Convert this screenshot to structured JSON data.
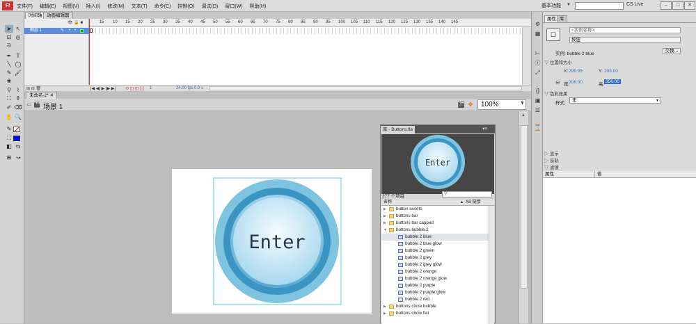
{
  "menubar": {
    "logo": "Fl",
    "items": [
      "文件(F)",
      "编辑(E)",
      "视图(V)",
      "插入(I)",
      "修改(M)",
      "文本(T)",
      "命令(C)",
      "控制(O)",
      "调试(D)",
      "窗口(W)",
      "帮助(H)"
    ],
    "workspace": "基本功能",
    "cslive": "CS Live"
  },
  "timeline": {
    "tabs": [
      "时间轴",
      "动画编辑器"
    ],
    "layer_name": "图层 1",
    "frame_numbers": [
      "1",
      "5",
      "10",
      "15",
      "20",
      "25",
      "30",
      "35",
      "40",
      "45",
      "50",
      "55",
      "60",
      "65",
      "70",
      "75",
      "80",
      "85",
      "90",
      "95",
      "100",
      "105",
      "110",
      "115",
      "120",
      "125",
      "130",
      "135",
      "140",
      "145"
    ],
    "footer_current_frame": "1",
    "fps": "24.00 fps",
    "time": "0.0 s"
  },
  "document": {
    "tab": "未命名-2*",
    "scene": "场景 1",
    "zoom": "100%"
  },
  "button_symbol": {
    "label": "Enter"
  },
  "library": {
    "title": "库 - Buttons.fla",
    "preview_label": "Enter",
    "count": "277 个项目",
    "col_name": "名称",
    "col_linkage": "AS 链接",
    "items": [
      {
        "name": "button assets",
        "type": "folder",
        "expand": "closed",
        "indent": 0
      },
      {
        "name": "buttons bar",
        "type": "folder",
        "expand": "closed",
        "indent": 0
      },
      {
        "name": "buttons bar capped",
        "type": "folder",
        "expand": "closed",
        "indent": 0
      },
      {
        "name": "buttons bubble 2",
        "type": "folder",
        "expand": "open",
        "indent": 0
      },
      {
        "name": "bubble 2 blue",
        "type": "symbol",
        "expand": "",
        "indent": 1,
        "selected": true
      },
      {
        "name": "bubble 2 blue glow",
        "type": "symbol",
        "expand": "",
        "indent": 1
      },
      {
        "name": "bubble 2 green",
        "type": "symbol",
        "expand": "",
        "indent": 1
      },
      {
        "name": "bubble 2 grey",
        "type": "symbol",
        "expand": "",
        "indent": 1
      },
      {
        "name": "bubble 2 grey glow",
        "type": "symbol",
        "expand": "",
        "indent": 1
      },
      {
        "name": "bubble 2 orange",
        "type": "symbol",
        "expand": "",
        "indent": 1
      },
      {
        "name": "bubble 2 orange glow",
        "type": "symbol",
        "expand": "",
        "indent": 1
      },
      {
        "name": "bubble 2 purple",
        "type": "symbol",
        "expand": "",
        "indent": 1
      },
      {
        "name": "bubble 2 purple glow",
        "type": "symbol",
        "expand": "",
        "indent": 1
      },
      {
        "name": "bubble 2 red",
        "type": "symbol",
        "expand": "",
        "indent": 1
      },
      {
        "name": "buttons circle bubble",
        "type": "folder",
        "expand": "closed",
        "indent": 0
      },
      {
        "name": "buttons circle flat",
        "type": "folder",
        "expand": "closed",
        "indent": 0
      }
    ]
  },
  "properties": {
    "tabs": [
      "属性",
      "库"
    ],
    "instance_name_placeholder": "<实例名称>",
    "instance_type": "按钮",
    "instance_label": "实例: bubble 2 blue",
    "swap_button": "交换...",
    "section_position": "位置和大小",
    "x_label": "X:",
    "x_value": "295.95",
    "y_label": "Y:",
    "y_value": "208.00",
    "w_label": "宽:",
    "w_value": "208.00",
    "h_label": "高:",
    "h_value": "356.00",
    "section_color": "色彩效果",
    "style_label": "样式:",
    "style_value": "无",
    "section_display": "显示",
    "section_track": "音轨",
    "section_filters": "滤镜",
    "col_property": "属性",
    "col_value": "值"
  },
  "colors": {
    "accent": "#2d6cc4",
    "bubble_outer": "#7ec3e0",
    "bubble_ring": "#3b95c3",
    "bubble_inner": "#d6eef8",
    "stroke_color": "#d62a2a",
    "fill_color": "#0a0aff"
  }
}
